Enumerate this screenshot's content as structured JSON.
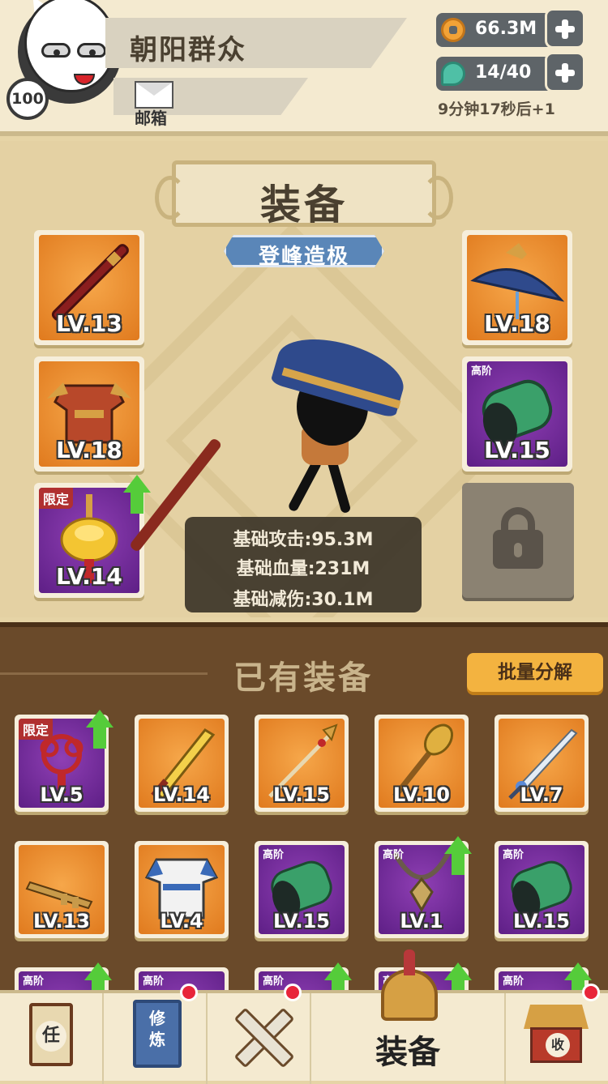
{
  "player": {
    "name": "朝阳群众",
    "level": "100",
    "mail_label": "邮箱"
  },
  "resources": {
    "gold": "66.3M",
    "energy": "14/40",
    "timer": "9分钟17秒后+1"
  },
  "equip_panel": {
    "title": "装备",
    "rank": "登峰造极",
    "slots": [
      {
        "level": "LV.13",
        "rarity": "orange",
        "item": "staff"
      },
      {
        "level": "LV.18",
        "rarity": "orange",
        "item": "armor"
      },
      {
        "level": "LV.14",
        "rarity": "purple",
        "item": "gold-pendant",
        "tag": "限定",
        "upgrade": true
      },
      {
        "level": "LV.18",
        "rarity": "orange",
        "item": "bamboo-hat"
      },
      {
        "level": "LV.15",
        "rarity": "purple",
        "item": "jade-bracer",
        "tag": "高阶"
      }
    ],
    "stats": {
      "attack": "基础攻击:95.3M",
      "hp": "基础血量:231M",
      "reduction": "基础减伤:30.1M"
    }
  },
  "inventory": {
    "title": "已有装备",
    "batch_button": "批量分解",
    "items": [
      {
        "level": "LV.5",
        "rarity": "purple",
        "item": "red-knot",
        "tag": "限定",
        "upgrade": true
      },
      {
        "level": "LV.14",
        "rarity": "orange",
        "item": "golden-sword"
      },
      {
        "level": "LV.15",
        "rarity": "orange",
        "item": "spear"
      },
      {
        "level": "LV.10",
        "rarity": "orange",
        "item": "mace"
      },
      {
        "level": "LV.7",
        "rarity": "orange",
        "item": "silver-sword"
      },
      {
        "level": "LV.13",
        "rarity": "orange",
        "item": "key-staff"
      },
      {
        "level": "LV.4",
        "rarity": "orange",
        "item": "robe"
      },
      {
        "level": "LV.15",
        "rarity": "purple",
        "item": "jade-bracer",
        "tag": "高阶"
      },
      {
        "level": "LV.1",
        "rarity": "purple",
        "item": "amulet",
        "tag": "高阶",
        "upgrade": true
      },
      {
        "level": "LV.15",
        "rarity": "purple",
        "item": "jade-bracer",
        "tag": "高阶"
      }
    ],
    "partial_row_tags": [
      "高阶",
      "高阶",
      "高阶",
      "高阶",
      "高阶"
    ]
  },
  "bottom_nav": {
    "task_icon_char": "任",
    "cultivate_icon_text": "修炼",
    "active_label": "装备",
    "collect_icon_char": "收"
  },
  "colors": {
    "orange_tile": "#e07a1e",
    "purple_tile": "#5e1f86",
    "upgrade_arrow": "#55cc3a",
    "batch_button": "#f3b340"
  }
}
